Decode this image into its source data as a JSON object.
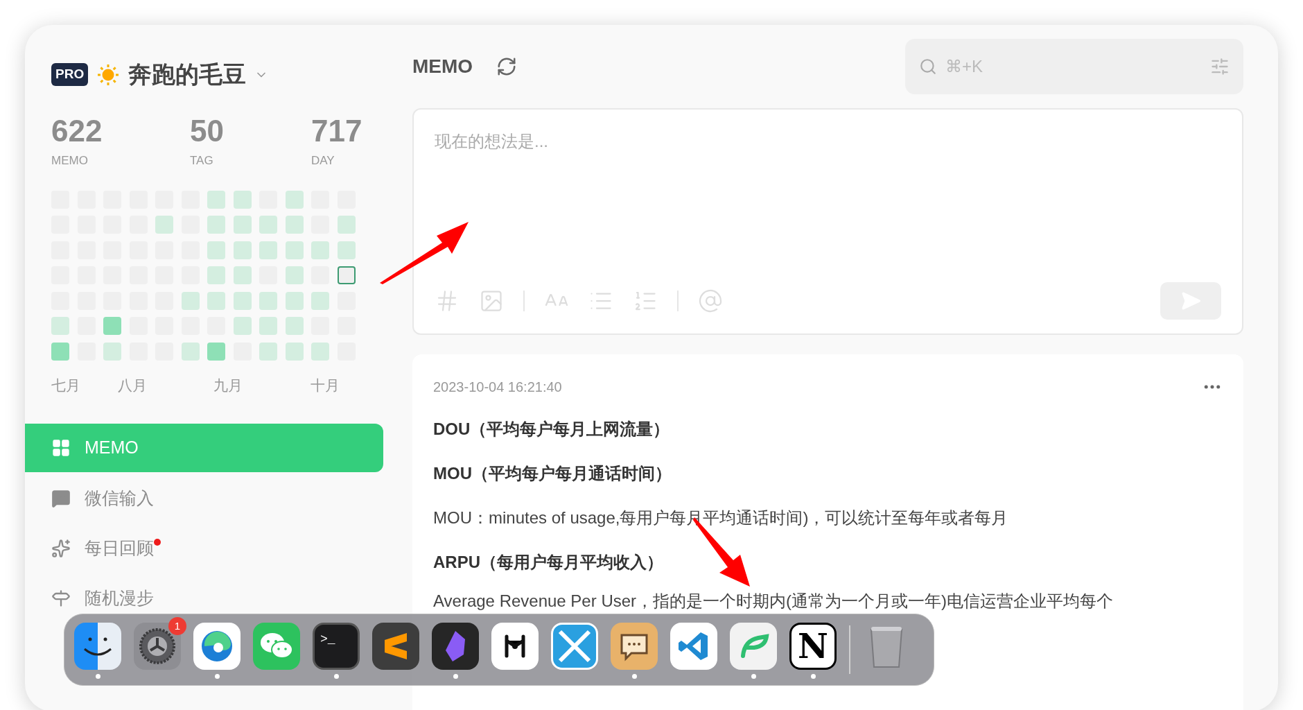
{
  "profile": {
    "badge": "PRO",
    "name": "奔跑的毛豆"
  },
  "stats": [
    {
      "value": "622",
      "label": "MEMO"
    },
    {
      "value": "50",
      "label": "TAG"
    },
    {
      "value": "717",
      "label": "DAY"
    }
  ],
  "heatmap": {
    "rows": [
      [
        {
          "kind": "empty",
          "today": false
        },
        {
          "kind": "empty",
          "today": false
        },
        {
          "kind": "empty",
          "today": false
        },
        {
          "kind": "empty",
          "today": false
        },
        {
          "kind": "empty",
          "today": false
        },
        {
          "kind": "empty",
          "today": false
        },
        {
          "kind": "light",
          "today": false
        },
        {
          "kind": "light",
          "today": false
        },
        {
          "kind": "empty",
          "today": false
        },
        {
          "kind": "light",
          "today": false
        },
        {
          "kind": "empty",
          "today": false
        },
        {
          "kind": "empty",
          "today": false
        }
      ],
      [
        {
          "kind": "empty",
          "today": false
        },
        {
          "kind": "empty",
          "today": false
        },
        {
          "kind": "empty",
          "today": false
        },
        {
          "kind": "empty",
          "today": false
        },
        {
          "kind": "light",
          "today": false
        },
        {
          "kind": "empty",
          "today": false
        },
        {
          "kind": "light",
          "today": false
        },
        {
          "kind": "light",
          "today": false
        },
        {
          "kind": "light",
          "today": false
        },
        {
          "kind": "light",
          "today": false
        },
        {
          "kind": "empty",
          "today": false
        },
        {
          "kind": "light",
          "today": false
        }
      ],
      [
        {
          "kind": "empty",
          "today": false
        },
        {
          "kind": "empty",
          "today": false
        },
        {
          "kind": "empty",
          "today": false
        },
        {
          "kind": "empty",
          "today": false
        },
        {
          "kind": "empty",
          "today": false
        },
        {
          "kind": "empty",
          "today": false
        },
        {
          "kind": "light",
          "today": false
        },
        {
          "kind": "light",
          "today": false
        },
        {
          "kind": "light",
          "today": false
        },
        {
          "kind": "light",
          "today": false
        },
        {
          "kind": "light",
          "today": false
        },
        {
          "kind": "light",
          "today": false
        }
      ],
      [
        {
          "kind": "empty",
          "today": false
        },
        {
          "kind": "empty",
          "today": false
        },
        {
          "kind": "empty",
          "today": false
        },
        {
          "kind": "empty",
          "today": false
        },
        {
          "kind": "empty",
          "today": false
        },
        {
          "kind": "empty",
          "today": false
        },
        {
          "kind": "light",
          "today": false
        },
        {
          "kind": "light",
          "today": false
        },
        {
          "kind": "empty",
          "today": false
        },
        {
          "kind": "light",
          "today": false
        },
        {
          "kind": "empty",
          "today": false
        },
        {
          "kind": "empty",
          "today": true
        }
      ],
      [
        {
          "kind": "empty",
          "today": false
        },
        {
          "kind": "empty",
          "today": false
        },
        {
          "kind": "empty",
          "today": false
        },
        {
          "kind": "empty",
          "today": false
        },
        {
          "kind": "empty",
          "today": false
        },
        {
          "kind": "light",
          "today": false
        },
        {
          "kind": "light",
          "today": false
        },
        {
          "kind": "light",
          "today": false
        },
        {
          "kind": "light",
          "today": false
        },
        {
          "kind": "light",
          "today": false
        },
        {
          "kind": "light",
          "today": false
        },
        {
          "kind": "empty",
          "today": false
        }
      ],
      [
        {
          "kind": "light",
          "today": false
        },
        {
          "kind": "empty",
          "today": false
        },
        {
          "kind": "dark",
          "today": false
        },
        {
          "kind": "empty",
          "today": false
        },
        {
          "kind": "empty",
          "today": false
        },
        {
          "kind": "empty",
          "today": false
        },
        {
          "kind": "empty",
          "today": false
        },
        {
          "kind": "light",
          "today": false
        },
        {
          "kind": "light",
          "today": false
        },
        {
          "kind": "light",
          "today": false
        },
        {
          "kind": "empty",
          "today": false
        },
        {
          "kind": "empty",
          "today": false
        }
      ],
      [
        {
          "kind": "dark",
          "today": false
        },
        {
          "kind": "empty",
          "today": false
        },
        {
          "kind": "light",
          "today": false
        },
        {
          "kind": "empty",
          "today": false
        },
        {
          "kind": "empty",
          "today": false
        },
        {
          "kind": "light",
          "today": false
        },
        {
          "kind": "dark",
          "today": false
        },
        {
          "kind": "empty",
          "today": false
        },
        {
          "kind": "light",
          "today": false
        },
        {
          "kind": "light",
          "today": false
        },
        {
          "kind": "light",
          "today": false
        },
        {
          "kind": "empty",
          "today": false
        }
      ]
    ],
    "months": [
      "七月",
      "八月",
      "九月",
      "十月"
    ]
  },
  "nav": [
    {
      "kind": "grid",
      "label": "MEMO",
      "selected": true,
      "dot": false
    },
    {
      "kind": "chat",
      "label": "微信输入",
      "selected": false,
      "dot": false
    },
    {
      "kind": "sparkle",
      "label": "每日回顾",
      "selected": false,
      "dot": true
    },
    {
      "kind": "signpost",
      "label": "随机漫步",
      "selected": false,
      "dot": false
    }
  ],
  "header": {
    "title": "MEMO",
    "search": {
      "placeholder": "⌘+K"
    }
  },
  "editor": {
    "placeholder": "现在的想法是..."
  },
  "memo": {
    "date": "2023-10-04 16:21:40",
    "blocks": [
      {
        "kind": "heading",
        "text": "DOU（平均每户每月上网流量）"
      },
      {
        "kind": "heading",
        "text": "MOU（平均每户每月通话时间）"
      },
      {
        "kind": "paragraph",
        "text": "MOU：minutes of usage,每用户每月平均通话时间)，可以统计至每年或者每月"
      },
      {
        "kind": "heading",
        "text": "ARPU（每用户每月平均收入）"
      },
      {
        "kind": "paragraph",
        "text": "Average Revenue Per User，指的是一个时期内(通常为一个月或一年)电信运营企业平均每个"
      }
    ]
  },
  "dock": [
    {
      "kind": "finder",
      "running": true
    },
    {
      "kind": "settings",
      "running": false,
      "badge": "1"
    },
    {
      "kind": "edge",
      "running": true
    },
    {
      "kind": "wechat",
      "running": false
    },
    {
      "kind": "terminal",
      "running": true,
      "glyph": ">_"
    },
    {
      "kind": "sublime",
      "running": false
    },
    {
      "kind": "obsidian",
      "running": true
    },
    {
      "kind": "dots",
      "running": false
    },
    {
      "kind": "cross",
      "running": false
    },
    {
      "kind": "bubble",
      "running": true
    },
    {
      "kind": "vscode",
      "running": false
    },
    {
      "kind": "leaf",
      "running": true
    },
    {
      "kind": "notion",
      "running": true,
      "glyph": "N"
    },
    {
      "kind": "trash",
      "running": false
    }
  ]
}
